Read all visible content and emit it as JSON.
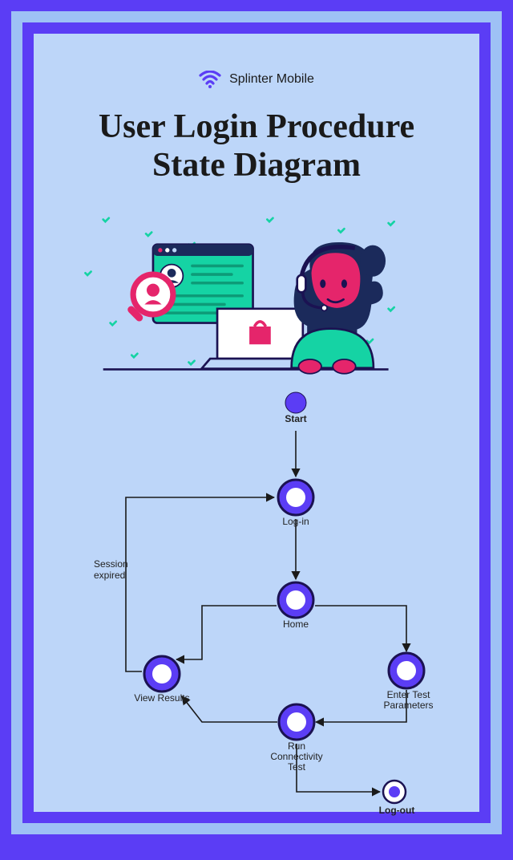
{
  "brand": {
    "name": "Splinter Mobile",
    "icon": "wifi-icon"
  },
  "title": {
    "line1": "User Login Procedure",
    "line2": "State Diagram"
  },
  "diagram": {
    "type": "state-diagram",
    "states": {
      "start": {
        "label": "Start",
        "kind": "initial"
      },
      "login": {
        "label": "Log-in",
        "kind": "state"
      },
      "home": {
        "label": "Home",
        "kind": "state"
      },
      "view": {
        "label": "View Results",
        "kind": "state"
      },
      "params": {
        "label": "Enter Test\nParameters",
        "kind": "state"
      },
      "run": {
        "label": "Run\nConnectivity\nTest",
        "kind": "state"
      },
      "logout": {
        "label": "Log-out",
        "kind": "final"
      }
    },
    "transitions": [
      {
        "from": "start",
        "to": "login",
        "label": ""
      },
      {
        "from": "login",
        "to": "home",
        "label": ""
      },
      {
        "from": "home",
        "to": "view",
        "label": ""
      },
      {
        "from": "home",
        "to": "params",
        "label": ""
      },
      {
        "from": "params",
        "to": "run",
        "label": ""
      },
      {
        "from": "run",
        "to": "view",
        "label": ""
      },
      {
        "from": "view",
        "to": "login",
        "label": "Session\nexpired"
      },
      {
        "from": "run",
        "to": "logout",
        "label": ""
      }
    ]
  },
  "colors": {
    "frame_outer": "#5b3df5",
    "frame_inner": "#9ec1f5",
    "page_bg": "#bdd6f9",
    "node_fill": "#ffffff",
    "node_ring": "#5b3df5",
    "node_outline": "#1b1252",
    "accent_pink": "#e5256b",
    "accent_teal": "#15d3a4",
    "accent_navy": "#1b2a5b"
  }
}
